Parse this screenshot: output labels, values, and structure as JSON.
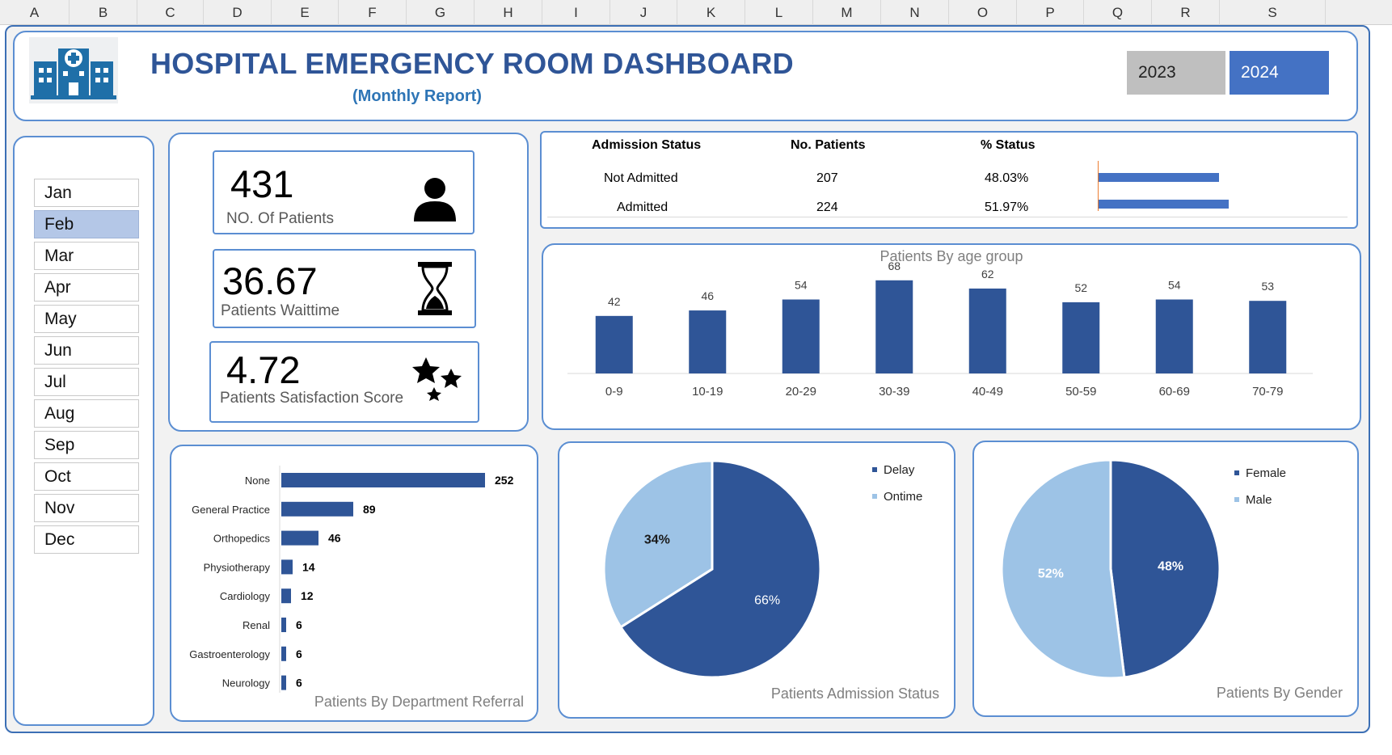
{
  "columns": [
    "A",
    "B",
    "C",
    "D",
    "E",
    "F",
    "G",
    "H",
    "I",
    "J",
    "K",
    "L",
    "M",
    "N",
    "O",
    "P",
    "Q",
    "R",
    "S"
  ],
  "header": {
    "title": "HOSPITAL EMERGENCY ROOM DASHBOARD",
    "subtitle": "(Monthly Report)",
    "years": [
      {
        "label": "2023",
        "selected": false
      },
      {
        "label": "2024",
        "selected": true
      }
    ]
  },
  "months": [
    {
      "label": "Jan",
      "selected": false
    },
    {
      "label": "Feb",
      "selected": true
    },
    {
      "label": "Mar",
      "selected": false
    },
    {
      "label": "Apr",
      "selected": false
    },
    {
      "label": "May",
      "selected": false
    },
    {
      "label": "Jun",
      "selected": false
    },
    {
      "label": "Jul",
      "selected": false
    },
    {
      "label": "Aug",
      "selected": false
    },
    {
      "label": "Sep",
      "selected": false
    },
    {
      "label": "Oct",
      "selected": false
    },
    {
      "label": "Nov",
      "selected": false
    },
    {
      "label": "Dec",
      "selected": false
    }
  ],
  "kpis": [
    {
      "value": "431",
      "label": "NO. Of Patients",
      "icon": "person-icon"
    },
    {
      "value": "36.67",
      "label": "Patients Waittime",
      "icon": "hourglass-icon"
    },
    {
      "value": "4.72",
      "label": "Patients Satisfaction Score",
      "icon": "stars-icon"
    }
  ],
  "admission_table": {
    "headers": [
      "Admission Status",
      "No. Patients",
      "% Status"
    ],
    "rows": [
      {
        "status": "Not Admitted",
        "patients": "207",
        "pct": "48.03%",
        "fraction": 0.4803
      },
      {
        "status": "Admitted",
        "patients": "224",
        "pct": "51.97%",
        "fraction": 0.5197
      }
    ]
  },
  "colors": {
    "accent": "#2f5597",
    "bar": "#2f5597",
    "light": "#9dc3e6",
    "border": "#5b8ed2",
    "table_bar": "#4472c4",
    "year_selected": "#4472c4",
    "year_unselected": "#bfbfbf"
  },
  "chart_data": [
    {
      "type": "bar",
      "title": "Patients By age group",
      "categories": [
        "0-9",
        "10-19",
        "20-29",
        "30-39",
        "40-49",
        "50-59",
        "60-69",
        "70-79"
      ],
      "values": [
        42,
        46,
        54,
        68,
        62,
        52,
        54,
        53
      ],
      "ylim": [
        0,
        72
      ],
      "grid": false
    },
    {
      "type": "bar",
      "orientation": "horizontal",
      "title": "Patients By Department Referral",
      "categories": [
        "None",
        "General Practice",
        "Orthopedics",
        "Physiotherapy",
        "Cardiology",
        "Renal",
        "Gastroenterology",
        "Neurology"
      ],
      "values": [
        252,
        89,
        46,
        14,
        12,
        6,
        6,
        6
      ],
      "xlim": [
        0,
        260
      ]
    },
    {
      "type": "pie",
      "title": "Patients Admission Status",
      "labels": [
        "Delay",
        "Ontime"
      ],
      "values": [
        66,
        34
      ],
      "value_labels": [
        "66%",
        "34%"
      ],
      "legend": "top-right"
    },
    {
      "type": "pie",
      "title": "Patients By Gender",
      "labels": [
        "Female",
        "Male"
      ],
      "values": [
        48,
        52
      ],
      "value_labels": [
        "48%",
        "52%"
      ],
      "legend": "top-right"
    }
  ]
}
